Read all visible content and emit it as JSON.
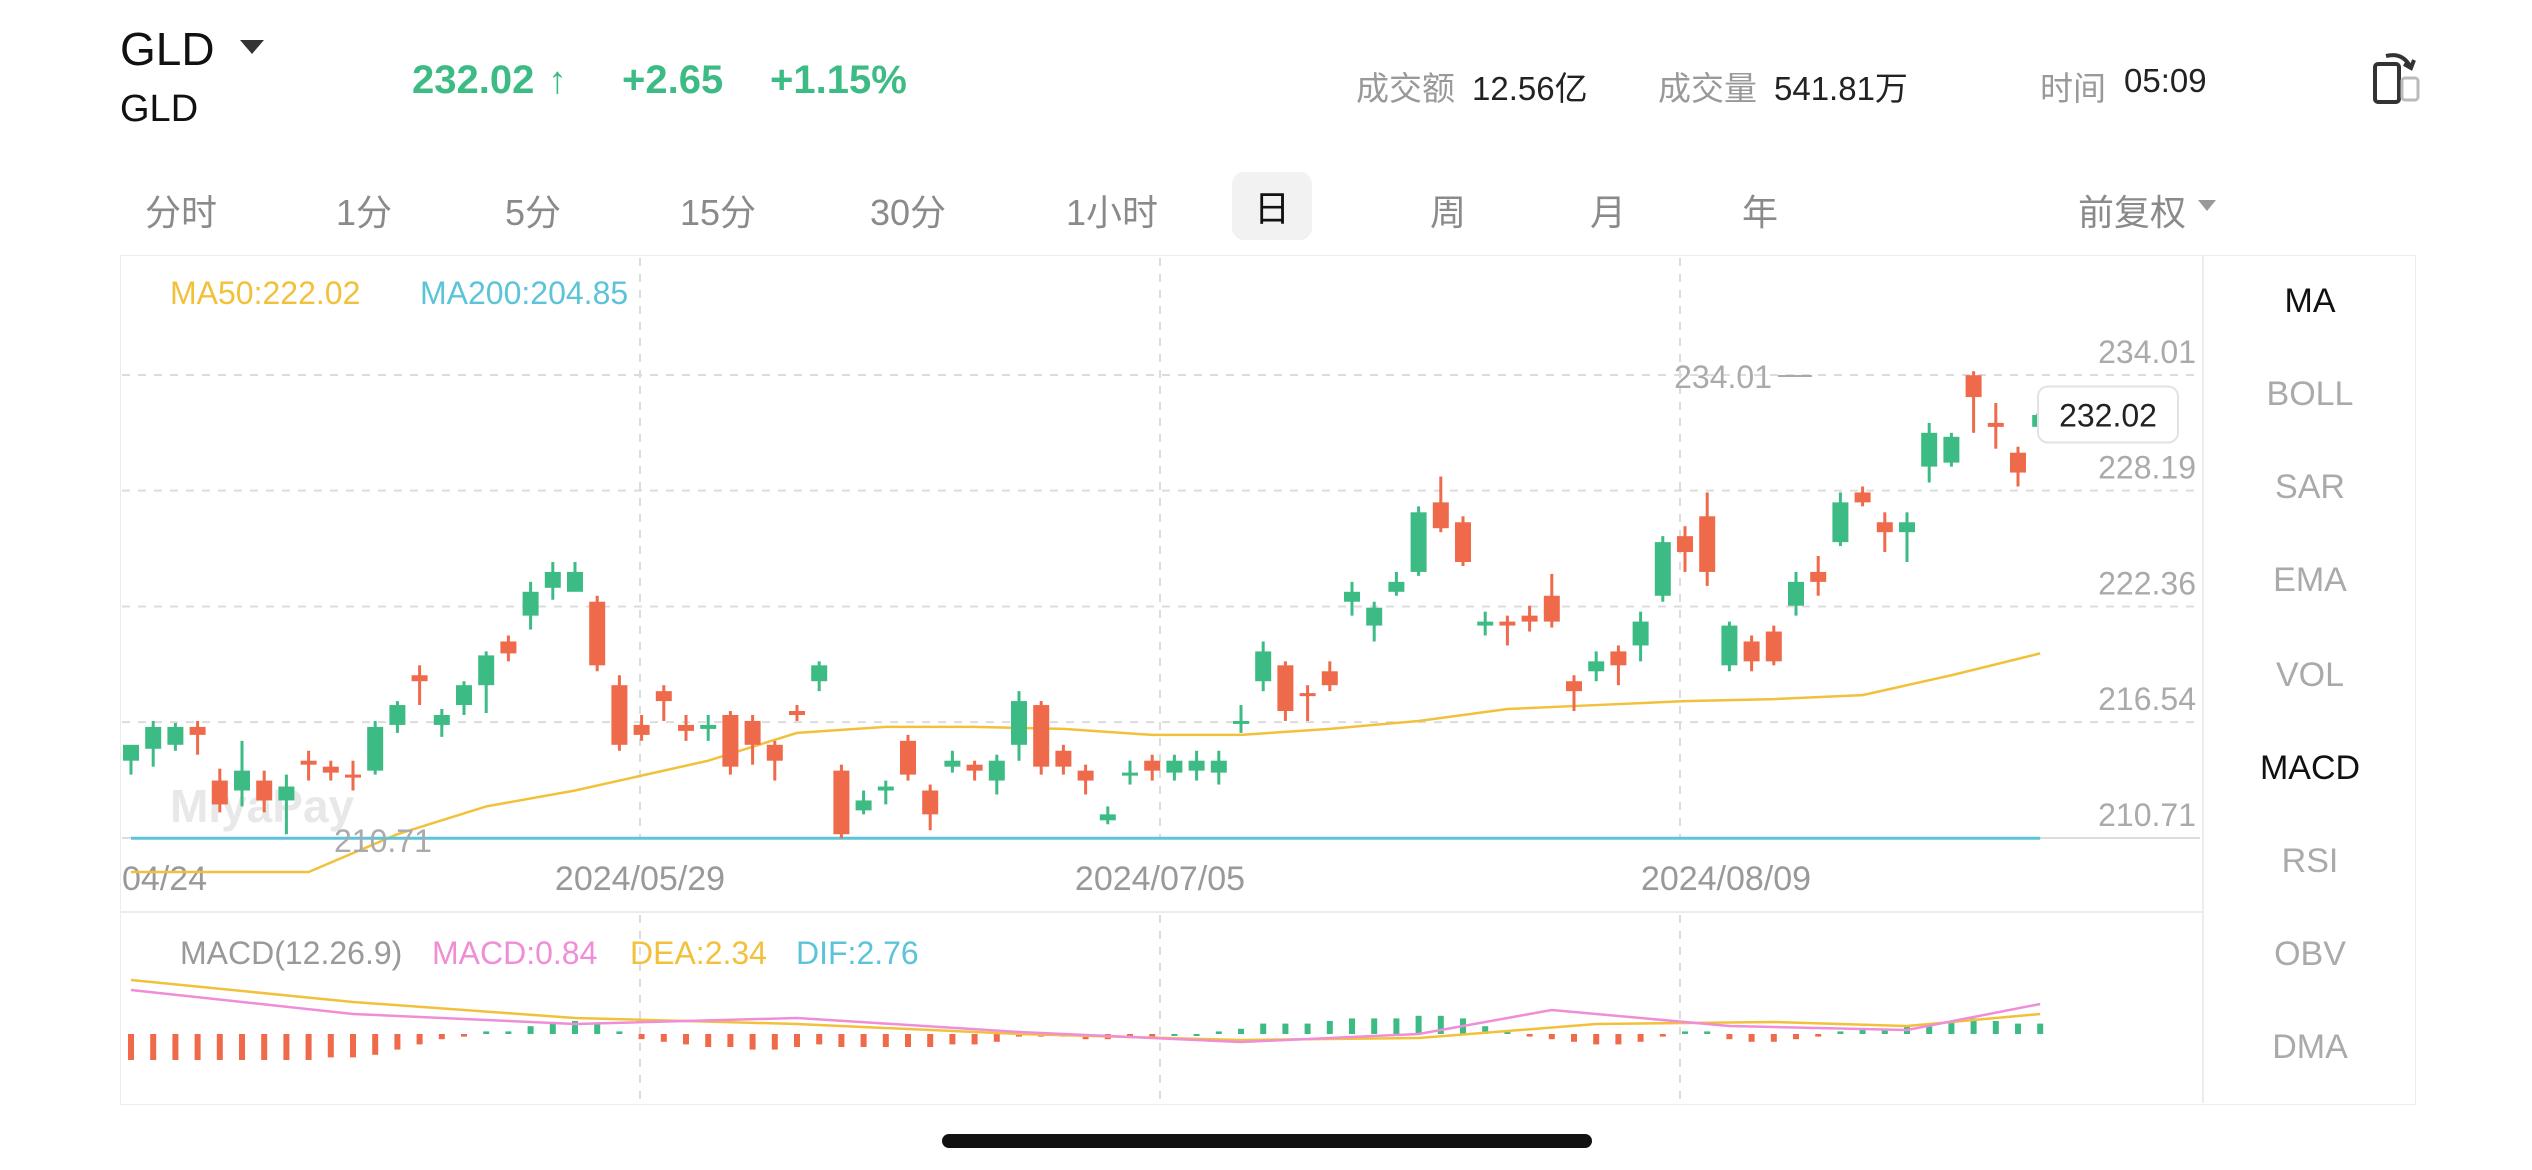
{
  "header": {
    "symbol": "GLD",
    "symbol_sub": "GLD",
    "price": "232.02",
    "arrow": "↑",
    "change": "+2.65",
    "change_pct": "+1.15%",
    "turnover_label": "成交额",
    "turnover_value": "12.56亿",
    "volume_label": "成交量",
    "volume_value": "541.81万",
    "time_label": "时间",
    "time_value": "05:09"
  },
  "tabs": [
    "分时",
    "1分",
    "5分",
    "15分",
    "30分",
    "1小时",
    "日",
    "周",
    "月",
    "年"
  ],
  "active_tab": "日",
  "adjust_label": "前复权",
  "indicators": [
    "MA",
    "BOLL",
    "SAR",
    "EMA",
    "VOL",
    "MACD",
    "RSI",
    "OBV",
    "DMA"
  ],
  "selected_indicators": [
    "MA",
    "MACD"
  ],
  "watermark": "MiyaPay",
  "colors": {
    "up": "#3dbb84",
    "down": "#ee6a4a",
    "ma50": "#f2c13b",
    "ma200": "#5bc4d9",
    "macd": "#ef8ed6",
    "dea": "#f2c13b",
    "dif": "#5bc4d9"
  },
  "chart_data": {
    "type": "candlestick",
    "legend": {
      "ma50": "MA50:222.02",
      "ma200": "MA200:204.85"
    },
    "y_ticks": [
      "234.01",
      "228.19",
      "222.36",
      "216.54",
      "210.71"
    ],
    "ylim": [
      210.71,
      234.01
    ],
    "x_ticks": [
      "04/24",
      "2024/05/29",
      "2024/07/05",
      "2024/08/09"
    ],
    "last_price_label": "232.02",
    "high_label": "234.01",
    "low_label": "210.71",
    "candles": [
      [
        214.6,
        215.4,
        215.3,
        213.9
      ],
      [
        215.2,
        216.3,
        216.6,
        214.3
      ],
      [
        215.4,
        216.3,
        216.5,
        215.1
      ],
      [
        216.3,
        215.9,
        216.6,
        214.9
      ],
      [
        213.6,
        212.4,
        214.2,
        212.0
      ],
      [
        213.1,
        214.1,
        215.6,
        212.3
      ],
      [
        213.6,
        212.6,
        214.1,
        212.0
      ],
      [
        212.6,
        213.3,
        213.9,
        210.9
      ],
      [
        214.6,
        214.4,
        215.1,
        213.6
      ],
      [
        214.3,
        214.0,
        214.6,
        213.6
      ],
      [
        213.9,
        213.8,
        214.6,
        213.1
      ],
      [
        214.1,
        216.3,
        216.6,
        213.9
      ],
      [
        216.4,
        217.4,
        217.6,
        216.0
      ],
      [
        218.9,
        218.6,
        219.4,
        217.4
      ],
      [
        216.4,
        216.9,
        217.2,
        215.8
      ],
      [
        217.4,
        218.4,
        218.6,
        216.9
      ],
      [
        218.4,
        219.9,
        220.1,
        217.0
      ],
      [
        220.6,
        220.0,
        220.9,
        219.6
      ],
      [
        221.9,
        223.1,
        223.6,
        221.2
      ],
      [
        223.3,
        224.1,
        224.6,
        222.7
      ],
      [
        223.1,
        224.1,
        224.6,
        223.3
      ],
      [
        222.6,
        219.4,
        222.9,
        219.1
      ],
      [
        218.4,
        215.4,
        218.9,
        215.1
      ],
      [
        216.4,
        215.9,
        216.9,
        215.6
      ],
      [
        218.1,
        217.6,
        218.4,
        216.6
      ],
      [
        216.4,
        216.1,
        216.9,
        215.6
      ],
      [
        216.2,
        216.4,
        216.9,
        215.6
      ],
      [
        216.9,
        214.3,
        217.1,
        213.9
      ],
      [
        216.6,
        215.4,
        216.9,
        214.4
      ],
      [
        215.4,
        214.6,
        215.6,
        213.6
      ],
      [
        217.1,
        216.9,
        217.4,
        216.6
      ],
      [
        218.6,
        219.4,
        219.6,
        218.1
      ],
      [
        214.1,
        210.9,
        214.4,
        210.7
      ],
      [
        212.1,
        212.6,
        213.1,
        211.9
      ],
      [
        213.1,
        213.3,
        213.6,
        212.4
      ],
      [
        215.6,
        213.9,
        215.9,
        213.6
      ],
      [
        213.1,
        211.9,
        213.4,
        211.1
      ],
      [
        214.3,
        214.6,
        215.1,
        214.0
      ],
      [
        214.4,
        214.1,
        214.6,
        213.6
      ],
      [
        213.6,
        214.6,
        214.9,
        212.9
      ],
      [
        215.4,
        217.6,
        218.1,
        214.6
      ],
      [
        217.4,
        214.3,
        217.6,
        213.9
      ],
      [
        215.1,
        214.3,
        215.4,
        213.9
      ],
      [
        214.1,
        213.6,
        214.4,
        212.9
      ],
      [
        211.6,
        211.9,
        212.3,
        211.4
      ],
      [
        213.9,
        214.0,
        214.6,
        213.4
      ],
      [
        214.6,
        214.1,
        214.9,
        213.6
      ],
      [
        214.0,
        214.6,
        214.9,
        213.6
      ],
      [
        214.1,
        214.6,
        215.1,
        213.6
      ],
      [
        214.0,
        214.6,
        215.1,
        213.4
      ],
      [
        216.6,
        216.6,
        217.4,
        216.0
      ],
      [
        218.6,
        220.1,
        220.6,
        218.1
      ],
      [
        219.4,
        217.1,
        219.6,
        216.6
      ],
      [
        218.0,
        217.9,
        218.4,
        216.6
      ],
      [
        219.1,
        218.4,
        219.6,
        218.1
      ],
      [
        222.6,
        223.1,
        223.6,
        221.9
      ],
      [
        221.4,
        222.3,
        222.6,
        220.6
      ],
      [
        223.1,
        223.6,
        224.1,
        222.9
      ],
      [
        224.1,
        227.1,
        227.4,
        223.9
      ],
      [
        227.6,
        226.3,
        228.9,
        226.1
      ],
      [
        226.6,
        224.6,
        226.9,
        224.4
      ],
      [
        221.4,
        221.6,
        222.1,
        220.9
      ],
      [
        221.6,
        221.4,
        221.9,
        220.4
      ],
      [
        221.9,
        221.6,
        222.4,
        221.1
      ],
      [
        222.9,
        221.6,
        224.0,
        221.3
      ],
      [
        218.6,
        218.1,
        218.9,
        217.1
      ],
      [
        219.1,
        219.6,
        220.1,
        218.6
      ],
      [
        220.1,
        219.4,
        220.4,
        218.4
      ],
      [
        220.4,
        221.6,
        222.1,
        219.6
      ],
      [
        222.9,
        225.6,
        225.9,
        222.6
      ],
      [
        225.9,
        225.1,
        226.4,
        224.1
      ],
      [
        226.9,
        224.1,
        228.1,
        223.4
      ],
      [
        219.4,
        221.4,
        221.6,
        219.1
      ],
      [
        220.6,
        219.6,
        220.9,
        219.1
      ],
      [
        221.1,
        219.6,
        221.4,
        219.4
      ],
      [
        222.4,
        223.6,
        224.1,
        221.9
      ],
      [
        224.1,
        223.6,
        224.9,
        222.9
      ],
      [
        225.6,
        227.6,
        228.1,
        225.4
      ],
      [
        228.1,
        227.6,
        228.4,
        227.4
      ],
      [
        226.6,
        226.1,
        227.1,
        225.1
      ],
      [
        226.1,
        226.6,
        227.1,
        224.6
      ],
      [
        229.4,
        231.1,
        231.6,
        228.6
      ],
      [
        229.6,
        230.9,
        231.1,
        229.4
      ],
      [
        234.0,
        232.9,
        234.2,
        231.1
      ],
      [
        231.6,
        231.4,
        232.6,
        230.3
      ],
      [
        230.1,
        229.1,
        230.4,
        228.4
      ],
      [
        231.4,
        232.0,
        232.6,
        230.9
      ]
    ],
    "ma50": [
      [
        0,
        209.0
      ],
      [
        8,
        209.0
      ],
      [
        12,
        210.9
      ],
      [
        16,
        212.3
      ],
      [
        20,
        213.1
      ],
      [
        26,
        214.6
      ],
      [
        30,
        216.0
      ],
      [
        34,
        216.3
      ],
      [
        38,
        216.3
      ],
      [
        42,
        216.2
      ],
      [
        46,
        215.9
      ],
      [
        50,
        215.9
      ],
      [
        54,
        216.2
      ],
      [
        58,
        216.6
      ],
      [
        62,
        217.2
      ],
      [
        66,
        217.4
      ],
      [
        70,
        217.6
      ],
      [
        74,
        217.7
      ],
      [
        78,
        217.9
      ],
      [
        82,
        218.9
      ],
      [
        86,
        220.0
      ]
    ],
    "ma200": [
      [
        0,
        210.8
      ],
      [
        86,
        210.8
      ]
    ],
    "macd": {
      "label": "MACD(12.26.9)",
      "macd_label": "MACD:0.84",
      "dea_label": "DEA:2.34",
      "dif_label": "DIF:2.76",
      "histogram": [
        -1.0,
        -1.0,
        -1.0,
        -1.0,
        -1.0,
        -1.0,
        -1.0,
        -1.0,
        -1.0,
        -0.9,
        -0.9,
        -0.8,
        -0.6,
        -0.4,
        -0.2,
        -0.1,
        0.1,
        0.1,
        0.3,
        0.4,
        0.5,
        0.4,
        0.1,
        -0.2,
        -0.3,
        -0.4,
        -0.5,
        -0.5,
        -0.6,
        -0.6,
        -0.5,
        -0.4,
        -0.5,
        -0.5,
        -0.5,
        -0.5,
        -0.5,
        -0.4,
        -0.4,
        -0.3,
        -0.1,
        -0.1,
        -0.1,
        -0.2,
        -0.2,
        -0.1,
        -0.1,
        0.0,
        0.0,
        0.1,
        0.2,
        0.4,
        0.4,
        0.4,
        0.5,
        0.6,
        0.6,
        0.6,
        0.7,
        0.7,
        0.6,
        0.3,
        0.1,
        -0.1,
        -0.2,
        -0.3,
        -0.4,
        -0.4,
        -0.3,
        -0.1,
        0.1,
        0.1,
        -0.2,
        -0.3,
        -0.3,
        -0.2,
        -0.1,
        0.1,
        0.2,
        0.2,
        0.3,
        0.4,
        0.5,
        0.6,
        0.5,
        0.4,
        0.4
      ]
    }
  }
}
